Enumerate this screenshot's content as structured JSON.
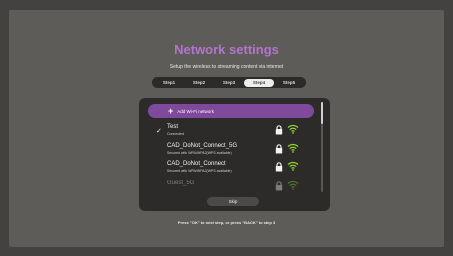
{
  "header": {
    "title": "Network settings",
    "subtitle": "Setup the wireless to streaming content via internet"
  },
  "steps": [
    "Step1",
    "Step2",
    "Step3",
    "Step4",
    "Step5"
  ],
  "active_step": "Step4",
  "add_network_label": "Add Wi-Fi network",
  "networks": [
    {
      "name": "Test",
      "status": "Connected",
      "checked": true,
      "locked": true
    },
    {
      "name": "CAD_DoNot_Connect_5G",
      "status": "Secured with WPA/WPA2(WPS available)",
      "checked": false,
      "locked": true
    },
    {
      "name": "CAD_DoNot_Connect",
      "status": "Secured with WPA/WPA2(WPS available)",
      "checked": false,
      "locked": true
    },
    {
      "name": "Guest_5G",
      "status": "",
      "checked": false,
      "locked": true
    }
  ],
  "skip_label": "Skip",
  "footer_hint": "Press \"OK\" to next step, or press \"BACK\" to step 3",
  "colors": {
    "accent": "#b573cf",
    "add_button": "#7f4a9c",
    "wifi": "#8ed12b"
  },
  "icons": {
    "check": "check-icon",
    "plus": "plus-icon",
    "lock": "lock-icon",
    "wifi": "wifi-icon"
  }
}
